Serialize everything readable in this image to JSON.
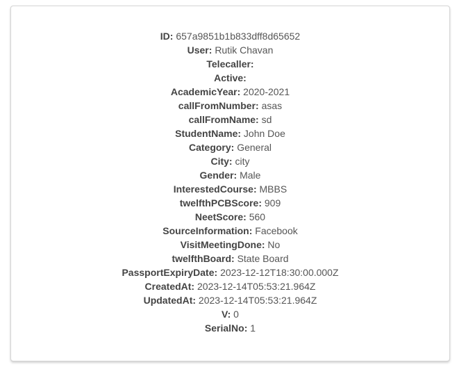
{
  "record": {
    "fields": [
      {
        "label": "ID:",
        "value": "657a9851b1b833dff8d65652"
      },
      {
        "label": "User:",
        "value": "Rutik Chavan"
      },
      {
        "label": "Telecaller:",
        "value": ""
      },
      {
        "label": "Active:",
        "value": ""
      },
      {
        "label": "AcademicYear:",
        "value": "2020-2021"
      },
      {
        "label": "callFromNumber:",
        "value": "asas"
      },
      {
        "label": "callFromName:",
        "value": "sd"
      },
      {
        "label": "StudentName:",
        "value": "John Doe"
      },
      {
        "label": "Category:",
        "value": "General"
      },
      {
        "label": "City:",
        "value": "city"
      },
      {
        "label": "Gender:",
        "value": "Male"
      },
      {
        "label": "InterestedCourse:",
        "value": "MBBS"
      },
      {
        "label": "twelfthPCBScore:",
        "value": "909"
      },
      {
        "label": "NeetScore:",
        "value": "560"
      },
      {
        "label": "SourceInformation:",
        "value": "Facebook"
      },
      {
        "label": "VisitMeetingDone:",
        "value": "No"
      },
      {
        "label": "twelfthBoard:",
        "value": "State Board"
      },
      {
        "label": "PassportExpiryDate:",
        "value": "2023-12-12T18:30:00.000Z"
      },
      {
        "label": "CreatedAt:",
        "value": "2023-12-14T05:53:21.964Z"
      },
      {
        "label": "UpdatedAt:",
        "value": "2023-12-14T05:53:21.964Z"
      },
      {
        "label": "V:",
        "value": "0"
      },
      {
        "label": "SerialNo:",
        "value": "1"
      }
    ]
  }
}
